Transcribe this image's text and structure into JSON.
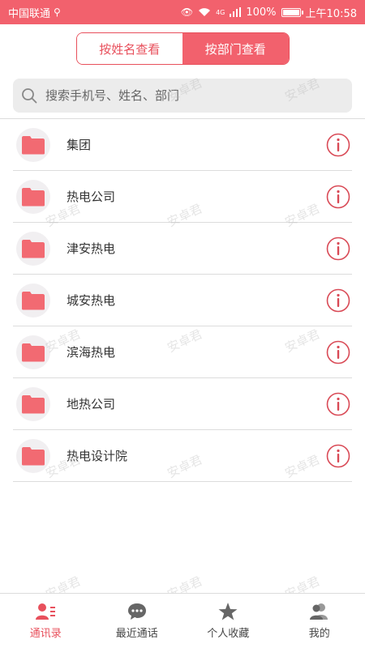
{
  "status_bar": {
    "carrier": "中国联通",
    "usb_icon": "usb-icon",
    "eye_icon": "eye-icon",
    "wifi_icon": "wifi-icon",
    "network": "4G",
    "battery_percent": "100%",
    "battery_level": 1.0,
    "time": "上午10:58"
  },
  "segment": {
    "by_name": "按姓名查看",
    "by_department": "按部门查看",
    "selected": "by_department"
  },
  "search": {
    "placeholder": "搜索手机号、姓名、部门",
    "value": ""
  },
  "departments": [
    {
      "label": "集团"
    },
    {
      "label": "热电公司"
    },
    {
      "label": "津安热电"
    },
    {
      "label": "城安热电"
    },
    {
      "label": "滨海热电"
    },
    {
      "label": "地热公司"
    },
    {
      "label": "热电设计院"
    }
  ],
  "tabbar": {
    "contacts": "通讯录",
    "recent": "最近通话",
    "favorites": "个人收藏",
    "mine": "我的",
    "active": "contacts"
  },
  "watermark": "安卓君",
  "colors": {
    "accent": "#f2616d",
    "accent_dark": "#e8505c",
    "folder": "#f26a72",
    "info_icon": "#d94a56"
  }
}
